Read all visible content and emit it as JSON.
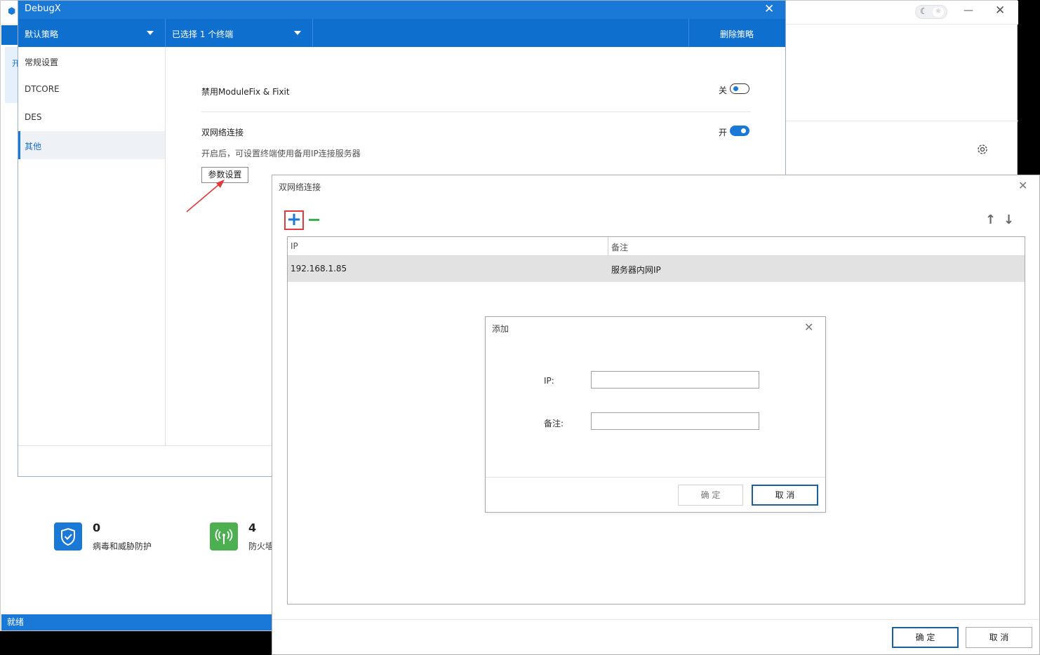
{
  "background_app": {
    "status_bar": "就绪",
    "stats": [
      {
        "value": "0",
        "label": "病毒和威胁防护",
        "icon": "shield-icon"
      },
      {
        "value": "4",
        "label": "防火墙",
        "icon": "wifi-tower-icon"
      }
    ],
    "side_card_text": "开"
  },
  "debugx": {
    "title": "DebugX",
    "toolbar": {
      "policy_select": "默认策略",
      "terminal_select": "已选择 1 个终端",
      "delete_button": "删除策略"
    },
    "sidebar": {
      "items": [
        {
          "label": "常规设置",
          "active": false
        },
        {
          "label": "DTCORE",
          "active": false
        },
        {
          "label": "DES",
          "active": false
        },
        {
          "label": "其他",
          "active": true
        }
      ]
    },
    "settings": {
      "disable_modulefix": {
        "label": "禁用ModuleFix & Fixit",
        "state_text": "关",
        "enabled": false
      },
      "dual_network": {
        "label": "双网络连接",
        "state_text": "开",
        "enabled": true,
        "description": "开启后，可设置终端使用备用IP连接服务器",
        "param_button": "参数设置"
      }
    }
  },
  "dual_dialog": {
    "title": "双网络连接",
    "columns": [
      "IP",
      "备注"
    ],
    "rows": [
      {
        "ip": "192.168.1.85",
        "note": "服务器内网IP"
      }
    ],
    "ok_button": "确 定",
    "cancel_button": "取 消"
  },
  "add_dialog": {
    "title": "添加",
    "ip_label": "IP:",
    "note_label": "备注:",
    "ip_value": "",
    "note_value": "",
    "ok_button": "确 定",
    "cancel_button": "取 消"
  },
  "colors": {
    "primary": "#1a78d6",
    "toolbar": "#0e6fcf",
    "add_icon": "#1a78d6",
    "remove_icon": "#3cb04a",
    "highlight": "#e03a3a",
    "row_selected": "#e2e2e2"
  }
}
